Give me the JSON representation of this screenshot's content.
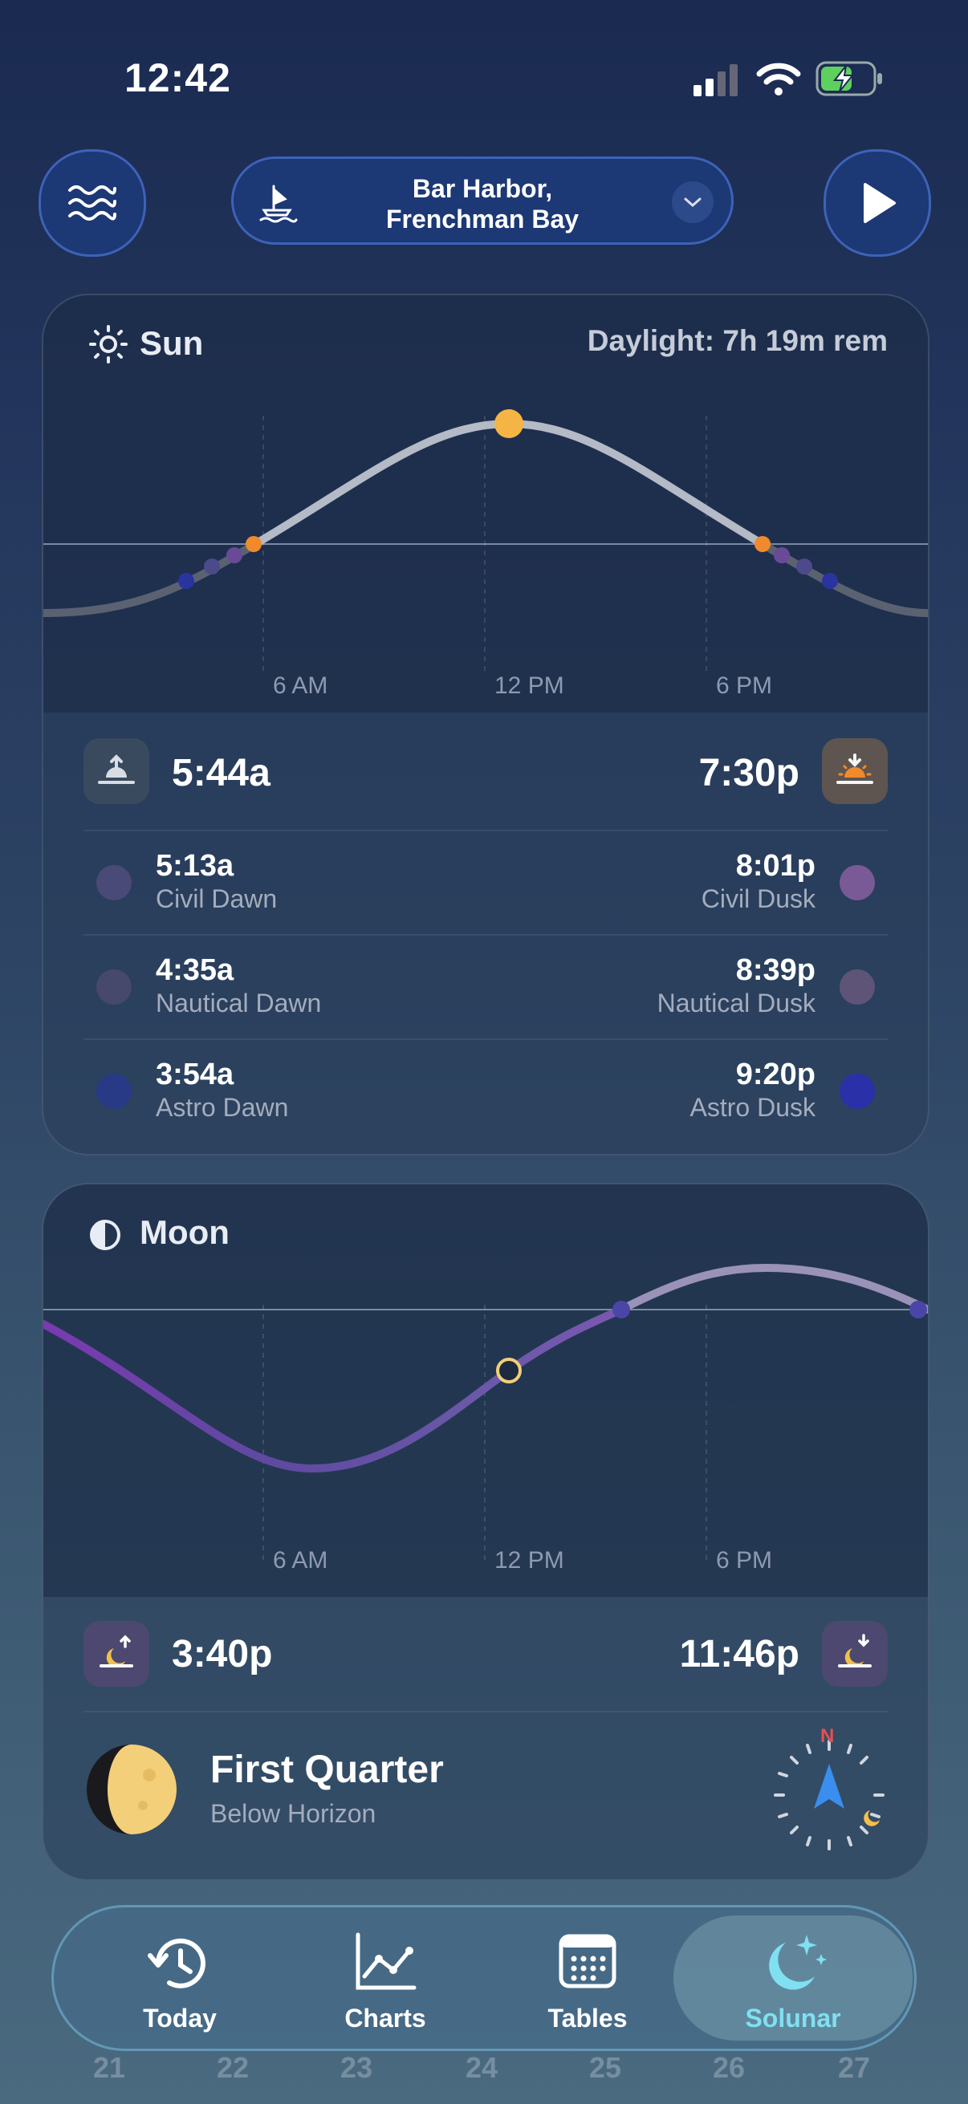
{
  "status": {
    "time": "12:42"
  },
  "location": {
    "name_line1": "Bar Harbor,",
    "name_line2": "Frenchman Bay"
  },
  "sun": {
    "title": "Sun",
    "daylight": "Daylight: 7h 19m rem",
    "axis": [
      "6 AM",
      "12 PM",
      "6 PM"
    ],
    "sunrise": "5:44a",
    "sunset": "7:30p",
    "twilight": [
      {
        "dawn_time": "5:13a",
        "dawn_label": "Civil Dawn",
        "dusk_time": "8:01p",
        "dusk_label": "Civil Dusk"
      },
      {
        "dawn_time": "4:35a",
        "dawn_label": "Nautical Dawn",
        "dusk_time": "8:39p",
        "dusk_label": "Nautical Dusk"
      },
      {
        "dawn_time": "3:54a",
        "dawn_label": "Astro Dawn",
        "dusk_time": "9:20p",
        "dusk_label": "Astro Dusk"
      }
    ]
  },
  "moon": {
    "title": "Moon",
    "axis": [
      "6 AM",
      "12 PM",
      "6 PM"
    ],
    "moonrise": "3:40p",
    "moonset": "11:46p",
    "phase": "First Quarter",
    "position": "Below Horizon",
    "compass_dir": "N"
  },
  "tabs": [
    {
      "label": "Today"
    },
    {
      "label": "Charts"
    },
    {
      "label": "Tables"
    },
    {
      "label": "Solunar"
    }
  ],
  "dates": [
    "21",
    "22",
    "23",
    "24",
    "25",
    "26",
    "27"
  ],
  "colors": {
    "accent": "#3d62b8",
    "sun": "#f5b544",
    "active_tab": "#7fe0f0"
  }
}
